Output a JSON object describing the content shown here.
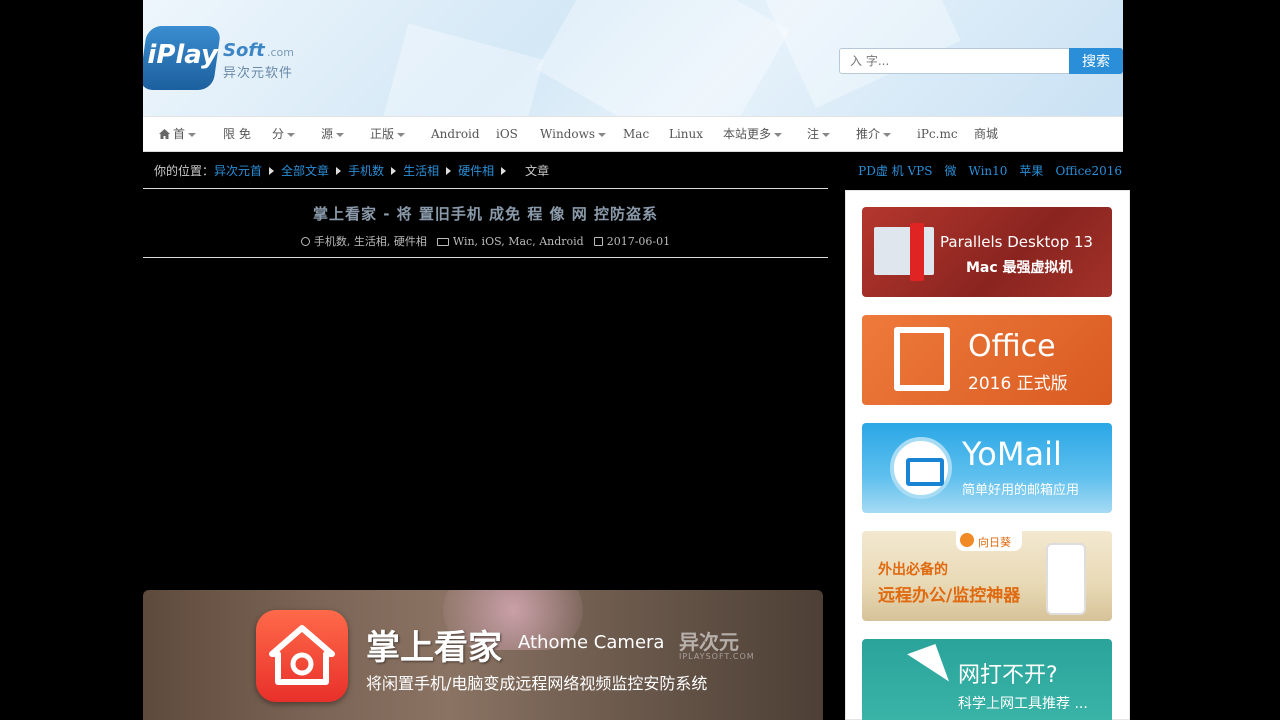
{
  "header": {
    "logo_main": "iPlay",
    "logo_soft": "Soft",
    "logo_com": ".com",
    "logo_cn": "异次元软件",
    "search_placeholder": "入 字...",
    "search_button": "搜索"
  },
  "nav": {
    "items": [
      {
        "label": "首",
        "dropdown": true,
        "icon": "home-icon"
      },
      {
        "label": "限 免",
        "dropdown": false
      },
      {
        "label": "分",
        "dropdown": true
      },
      {
        "label": "源",
        "dropdown": true
      },
      {
        "label": "正版",
        "dropdown": true
      },
      {
        "label": "Android",
        "dropdown": false
      },
      {
        "label": "iOS",
        "dropdown": false
      },
      {
        "label": "Windows",
        "dropdown": true
      },
      {
        "label": "Mac",
        "dropdown": false
      },
      {
        "label": "Linux",
        "dropdown": false
      },
      {
        "label": "本站更多",
        "dropdown": true
      },
      {
        "label": "注",
        "dropdown": true
      },
      {
        "label": "推介",
        "dropdown": true
      },
      {
        "label": "iPc.mc",
        "dropdown": false
      },
      {
        "label": "商城",
        "dropdown": false
      }
    ]
  },
  "breadcrumb": {
    "prefix": "你的位置：",
    "links": [
      "异次元首",
      "全部文章",
      "手机数",
      "生活相",
      "硬件相"
    ],
    "current": "文章"
  },
  "quick_links": [
    "PD虚 机 VPS",
    "微",
    "Win10",
    "苹果",
    "Office2016"
  ],
  "article": {
    "title": "掌上看家 - 将  置旧手机    成免   程 像 网   控防盗系",
    "categories": "手机数, 生活相, 硬件相",
    "platforms": "Win, iOS, Mac, Android",
    "date": "2017-06-01"
  },
  "banner": {
    "title": "掌上看家",
    "title_en": "Athome Camera",
    "brand": "异次元",
    "brand_sub": "IPLAYSOFT.COM",
    "subtitle": "将闲置手机/电脑变成远程网络视频监控安防系统"
  },
  "sidebar": {
    "ads": [
      {
        "line1": "Parallels Desktop 13",
        "line2": "Mac 最强虚拟机"
      },
      {
        "line1": "Office",
        "line2": "2016 正式版"
      },
      {
        "line1": "YoMail",
        "line2": "简单好用的邮箱应用"
      },
      {
        "tag": "向日葵",
        "line1": "外出必备的",
        "line2": "远程办公/监控神器"
      },
      {
        "line1": "网打不开?",
        "line2": "科学上网工具推荐 ..."
      }
    ]
  }
}
